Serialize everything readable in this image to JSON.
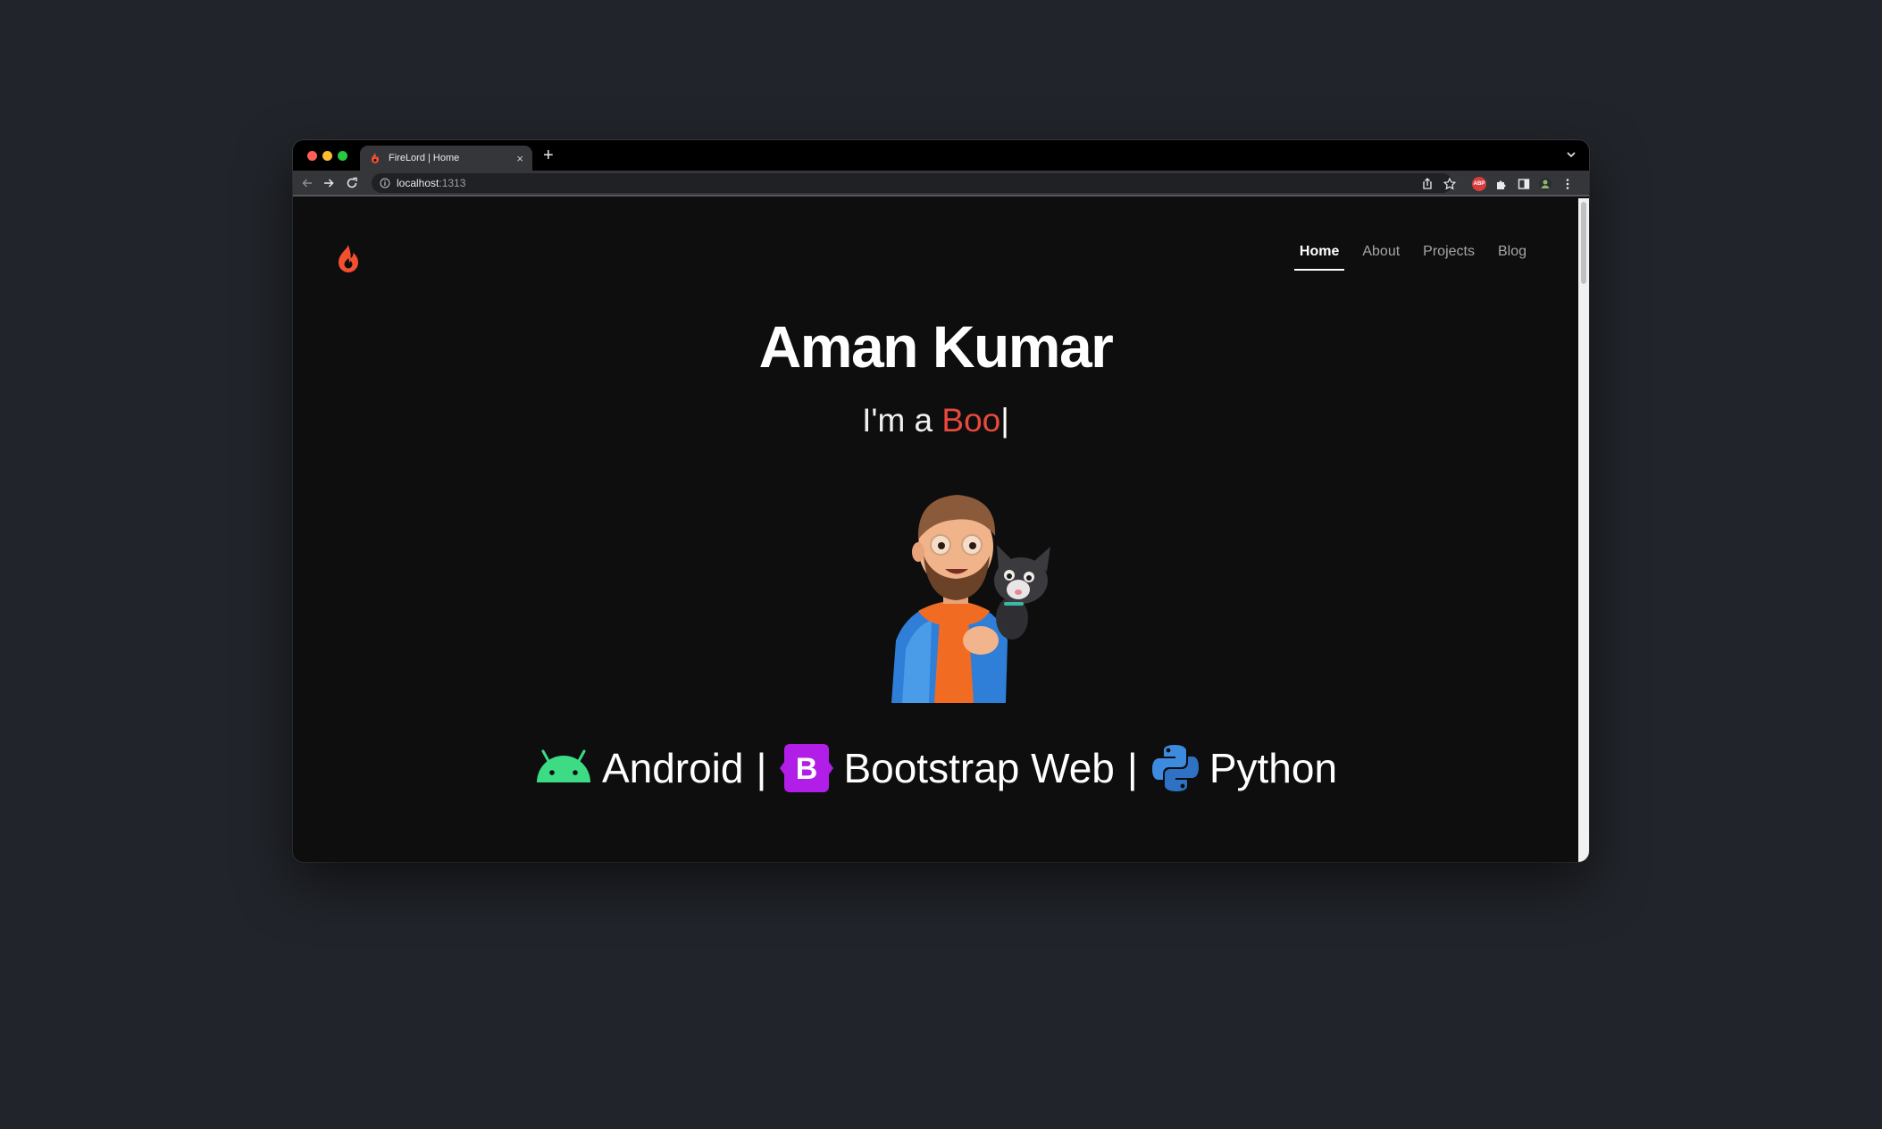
{
  "browser": {
    "tab_title": "FireLord | Home",
    "tab_close": "×",
    "new_tab": "+",
    "url_host": "localhost",
    "url_port": ":1313",
    "extension_badge": "ABP"
  },
  "site": {
    "nav": [
      {
        "label": "Home"
      },
      {
        "label": "About"
      },
      {
        "label": "Projects"
      },
      {
        "label": "Blog"
      }
    ],
    "hero": {
      "name": "Aman Kumar",
      "prefix": "I'm a ",
      "typed": "Boo",
      "caret": "|"
    },
    "skills": [
      {
        "label": "Android",
        "icon": "android-icon"
      },
      {
        "label": "Bootstrap Web",
        "icon": "bootstrap-icon"
      },
      {
        "label": "Python",
        "icon": "python-icon"
      }
    ],
    "separator": "|"
  },
  "colors": {
    "accent": "#e8493c",
    "android": "#3ddc84",
    "bootstrap": "#7952b3",
    "python_blue": "#3776ab",
    "page_bg": "#0e0e0f"
  }
}
